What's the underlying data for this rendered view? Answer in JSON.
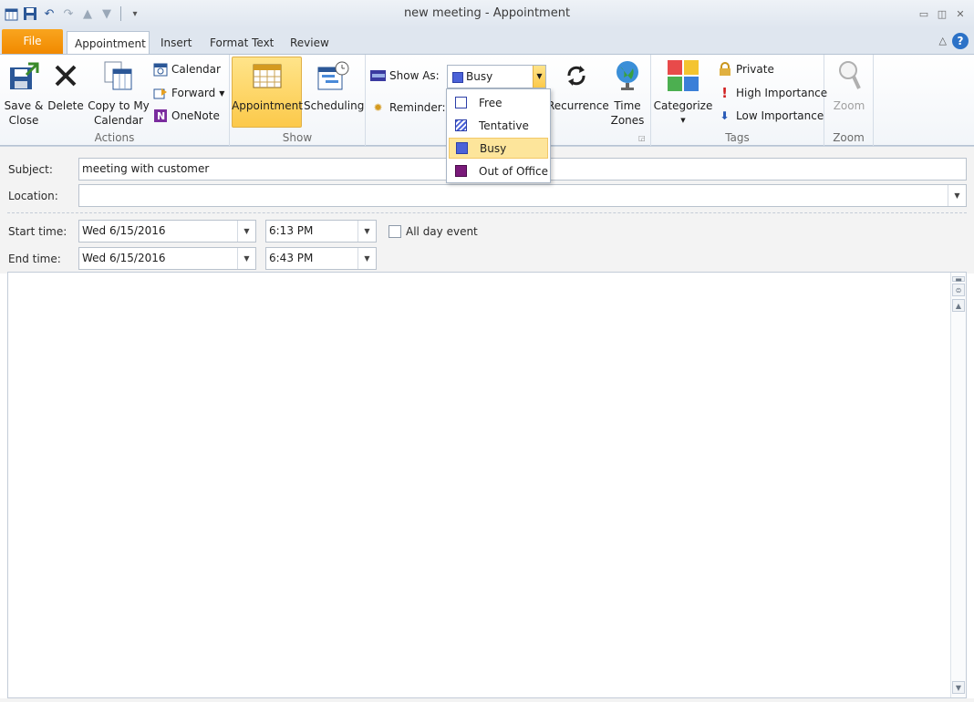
{
  "window": {
    "title": "new meeting  -  Appointment",
    "controls": [
      "minimize",
      "restore",
      "close"
    ]
  },
  "quick_access": {
    "icons": [
      "calendar-app-icon",
      "save-icon",
      "undo-icon",
      "redo-icon",
      "up-arrow-icon",
      "down-arrow-icon",
      "customize-icon"
    ]
  },
  "tabs": [
    {
      "label": "File"
    },
    {
      "label": "Appointment"
    },
    {
      "label": "Insert"
    },
    {
      "label": "Format Text"
    },
    {
      "label": "Review"
    }
  ],
  "ribbon": {
    "actions": {
      "label": "Actions",
      "save_close_line1": "Save &",
      "save_close_line2": "Close",
      "delete": "Delete",
      "copy_line1": "Copy to My",
      "copy_line2": "Calendar",
      "calendar": "Calendar",
      "forward": "Forward",
      "onenote": "OneNote"
    },
    "show": {
      "label": "Show",
      "appointment": "Appointment",
      "scheduling": "Scheduling"
    },
    "options": {
      "show_as_label": "Show As:",
      "show_as_value": "Busy",
      "reminder_label": "Reminder:",
      "recurrence": "Recurrence",
      "time_zones_line1": "Time",
      "time_zones_line2": "Zones"
    },
    "tags": {
      "label": "Tags",
      "categorize": "Categorize",
      "private": "Private",
      "high_importance": "High Importance",
      "low_importance": "Low Importance"
    },
    "zoom": {
      "label": "Zoom",
      "zoom": "Zoom"
    }
  },
  "show_as_options": [
    {
      "label": "Free",
      "color": "#ffffff",
      "selected": false
    },
    {
      "label": "Tentative",
      "color": "#4b62d8",
      "selected": false
    },
    {
      "label": "Busy",
      "color": "#4b62d8",
      "selected": true
    },
    {
      "label": "Out of Office",
      "color": "#7a1a7a",
      "selected": false
    }
  ],
  "form": {
    "subject_label": "Subject:",
    "subject_value": "meeting with customer",
    "location_label": "Location:",
    "location_value": "",
    "start_label": "Start time:",
    "start_date": "Wed 6/15/2016",
    "start_time": "6:13 PM",
    "all_day_label": "All day event",
    "all_day_checked": false,
    "end_label": "End time:",
    "end_date": "Wed 6/15/2016",
    "end_time": "6:43 PM"
  },
  "colors": {
    "accent_file": "#f18900",
    "selected_highlight": "#fcc94a",
    "brand_blue": "#2c72c7"
  }
}
